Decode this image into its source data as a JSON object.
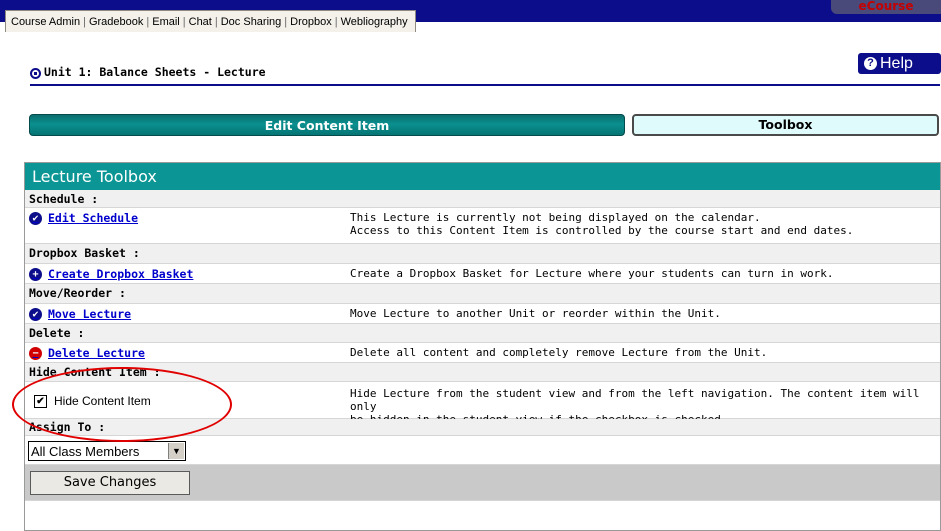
{
  "nav": {
    "tabs": [
      "Course Admin",
      "Gradebook",
      "Email",
      "Chat",
      "Doc Sharing",
      "Dropbox",
      "Webliography"
    ],
    "logo_text": "eCourse"
  },
  "unit": {
    "title": "Unit 1: Balance Sheets - Lecture"
  },
  "help": {
    "label": "Help",
    "icon": "?"
  },
  "tabs": {
    "edit_label": "Edit Content Item",
    "toolbox_label": "Toolbox"
  },
  "toolbox": {
    "title": "Lecture Toolbox",
    "sections": {
      "schedule": {
        "title": "Schedule :",
        "link": "Edit Schedule",
        "desc_line1": "This Lecture is currently not being displayed on the calendar.",
        "desc_line2": "Access to this Content Item is controlled by the course start and end dates."
      },
      "dropbox": {
        "title": "Dropbox Basket :",
        "link": "Create Dropbox Basket",
        "desc": "Create a Dropbox Basket for Lecture where your students can turn in work."
      },
      "move": {
        "title": "Move/Reorder :",
        "link": "Move Lecture",
        "desc": "Move Lecture to another Unit or reorder within the Unit."
      },
      "delete": {
        "title": "Delete :",
        "link": "Delete Lecture",
        "desc": "Delete all content and completely remove Lecture from the Unit."
      },
      "hide": {
        "title": "Hide Content Item :",
        "checkbox_label": "Hide Content Item",
        "checked": true,
        "desc_line1": "Hide Lecture from the student view and from the left navigation. The content item will only",
        "desc_line2": "be hidden in the student view if the checkbox is checked."
      },
      "assign": {
        "title": "Assign To :",
        "selected": "All Class Members"
      }
    },
    "save_label": "Save Changes"
  },
  "colors": {
    "navy": "#0b0d8a",
    "teal": "#0b9595",
    "annotation_red": "#e10000"
  }
}
